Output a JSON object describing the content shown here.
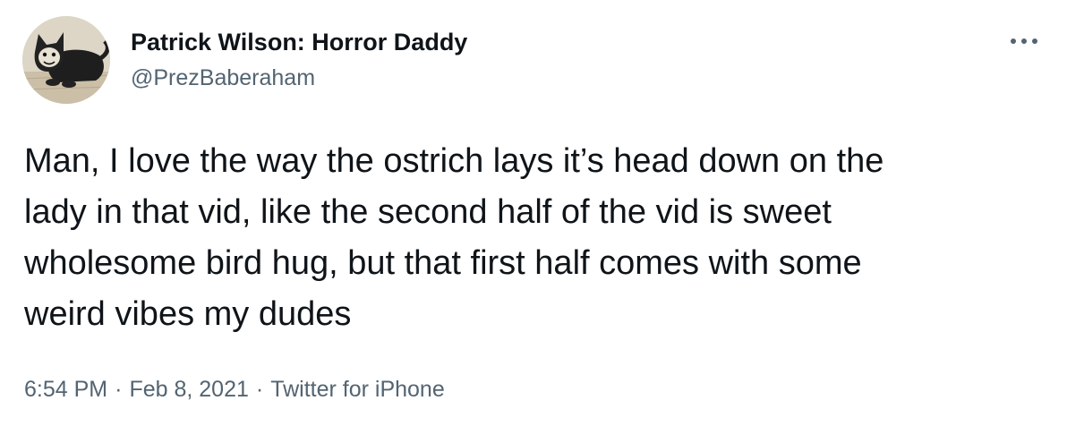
{
  "author": {
    "display_name": "Patrick Wilson: Horror Daddy",
    "handle": "@PrezBaberaham",
    "avatar_icon": "cat-drawing-avatar"
  },
  "more_icon": "more-dots-icon",
  "tweet": {
    "lines": [
      "Man, I love the way the ostrich lays it’s head down on the",
      "lady in that vid, like the second half of the vid is sweet",
      "wholesome bird hug, but that first half comes with some",
      "weird vibes my dudes"
    ]
  },
  "meta": {
    "time": "6:54 PM",
    "date": "Feb 8, 2021",
    "source": "Twitter for iPhone",
    "separator": "·"
  },
  "colors": {
    "text": "#0f1419",
    "secondary": "#536471",
    "background": "#ffffff"
  }
}
